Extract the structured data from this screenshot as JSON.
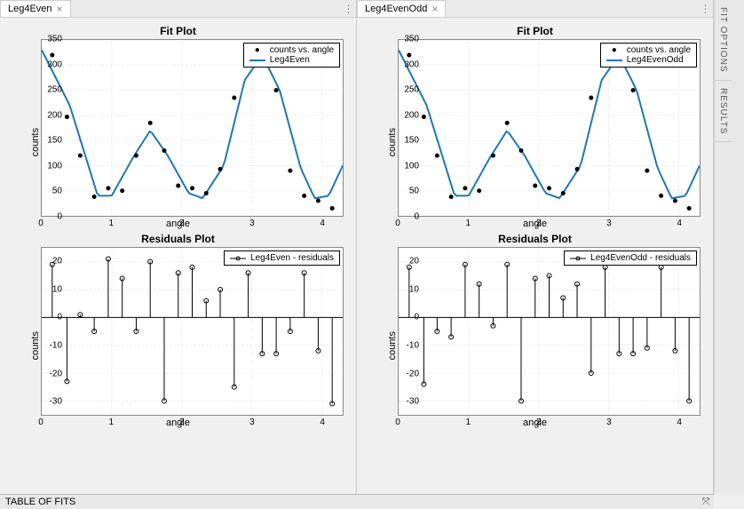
{
  "tabs": {
    "left": "Leg4Even",
    "right": "Leg4EvenOdd"
  },
  "side_tabs": {
    "fit_options": "FIT OPTIONS",
    "results": "RESULTS"
  },
  "bottom": {
    "table_of_fits": "TABLE OF FITS"
  },
  "chart_data": [
    {
      "owner_tab": "Leg4Even",
      "type": "line+scatter",
      "title": "Fit Plot",
      "xlabel": "angle",
      "ylabel": "counts",
      "xlim": [
        0,
        4.3
      ],
      "ylim": [
        0,
        350
      ],
      "yticks": [
        0,
        50,
        100,
        150,
        200,
        250,
        300,
        350
      ],
      "xticks": [
        0,
        1,
        2,
        3,
        4
      ],
      "legend": [
        {
          "kind": "dot",
          "label": "counts vs. angle"
        },
        {
          "kind": "line",
          "label": "Leg4Even"
        }
      ],
      "scatter": {
        "x": [
          0.15,
          0.36,
          0.55,
          0.75,
          0.95,
          1.15,
          1.35,
          1.55,
          1.75,
          1.95,
          2.15,
          2.35,
          2.55,
          2.75,
          2.95,
          3.15,
          3.35,
          3.55,
          3.75,
          3.95,
          4.15
        ],
        "y": [
          320,
          197,
          120,
          38,
          55,
          50,
          120,
          185,
          130,
          60,
          55,
          45,
          93,
          235,
          305,
          305,
          250,
          90,
          40,
          30,
          15
        ]
      },
      "fit_curve": {
        "kind": "leg4even",
        "xlim": [
          0,
          4.3
        ]
      }
    },
    {
      "owner_tab": "Leg4Even",
      "type": "stem",
      "title": "Residuals Plot",
      "xlabel": "angle",
      "ylabel": "counts",
      "xlim": [
        0,
        4.3
      ],
      "ylim": [
        -35,
        25
      ],
      "yticks": [
        -30,
        -20,
        -10,
        0,
        10,
        20
      ],
      "xticks": [
        0,
        1,
        2,
        3,
        4
      ],
      "legend": [
        {
          "kind": "stem",
          "label": "Leg4Even - residuals"
        }
      ],
      "stems": {
        "x": [
          0.15,
          0.36,
          0.55,
          0.75,
          0.95,
          1.15,
          1.35,
          1.55,
          1.75,
          1.95,
          2.15,
          2.35,
          2.55,
          2.75,
          2.95,
          3.15,
          3.35,
          3.55,
          3.75,
          3.95,
          4.15
        ],
        "y": [
          19,
          -23,
          1,
          -5,
          21,
          14,
          -5,
          20,
          -30,
          16,
          18,
          6,
          10,
          -25,
          16,
          -13,
          -13,
          -5,
          16,
          -12,
          -31
        ]
      }
    },
    {
      "owner_tab": "Leg4EvenOdd",
      "type": "line+scatter",
      "title": "Fit Plot",
      "xlabel": "angle",
      "ylabel": "counts",
      "xlim": [
        0,
        4.3
      ],
      "ylim": [
        0,
        350
      ],
      "yticks": [
        0,
        50,
        100,
        150,
        200,
        250,
        300,
        350
      ],
      "xticks": [
        0,
        1,
        2,
        3,
        4
      ],
      "legend": [
        {
          "kind": "dot",
          "label": "counts vs. angle"
        },
        {
          "kind": "line",
          "label": "Leg4EvenOdd"
        }
      ],
      "scatter": {
        "x": [
          0.15,
          0.36,
          0.55,
          0.75,
          0.95,
          1.15,
          1.35,
          1.55,
          1.75,
          1.95,
          2.15,
          2.35,
          2.55,
          2.75,
          2.95,
          3.15,
          3.35,
          3.55,
          3.75,
          3.95,
          4.15
        ],
        "y": [
          320,
          197,
          120,
          38,
          55,
          50,
          120,
          185,
          130,
          60,
          55,
          45,
          93,
          235,
          305,
          305,
          250,
          90,
          40,
          30,
          15
        ]
      },
      "fit_curve": {
        "kind": "leg4evenodd",
        "xlim": [
          0,
          4.3
        ]
      }
    },
    {
      "owner_tab": "Leg4EvenOdd",
      "type": "stem",
      "title": "Residuals Plot",
      "xlabel": "angle",
      "ylabel": "counts",
      "xlim": [
        0,
        4.3
      ],
      "ylim": [
        -35,
        25
      ],
      "yticks": [
        -30,
        -20,
        -10,
        0,
        10,
        20
      ],
      "xticks": [
        0,
        1,
        2,
        3,
        4
      ],
      "legend": [
        {
          "kind": "stem",
          "label": "Leg4EvenOdd - residuals"
        }
      ],
      "stems": {
        "x": [
          0.15,
          0.36,
          0.55,
          0.75,
          0.95,
          1.15,
          1.35,
          1.55,
          1.75,
          1.95,
          2.15,
          2.35,
          2.55,
          2.75,
          2.95,
          3.15,
          3.35,
          3.55,
          3.75,
          3.95,
          4.15
        ],
        "y": [
          18,
          -24,
          -5,
          -7,
          19,
          12,
          -3,
          19,
          -30,
          14,
          15,
          7,
          12,
          -20,
          18,
          -13,
          -13,
          -11,
          18,
          -12,
          -30
        ]
      }
    }
  ]
}
